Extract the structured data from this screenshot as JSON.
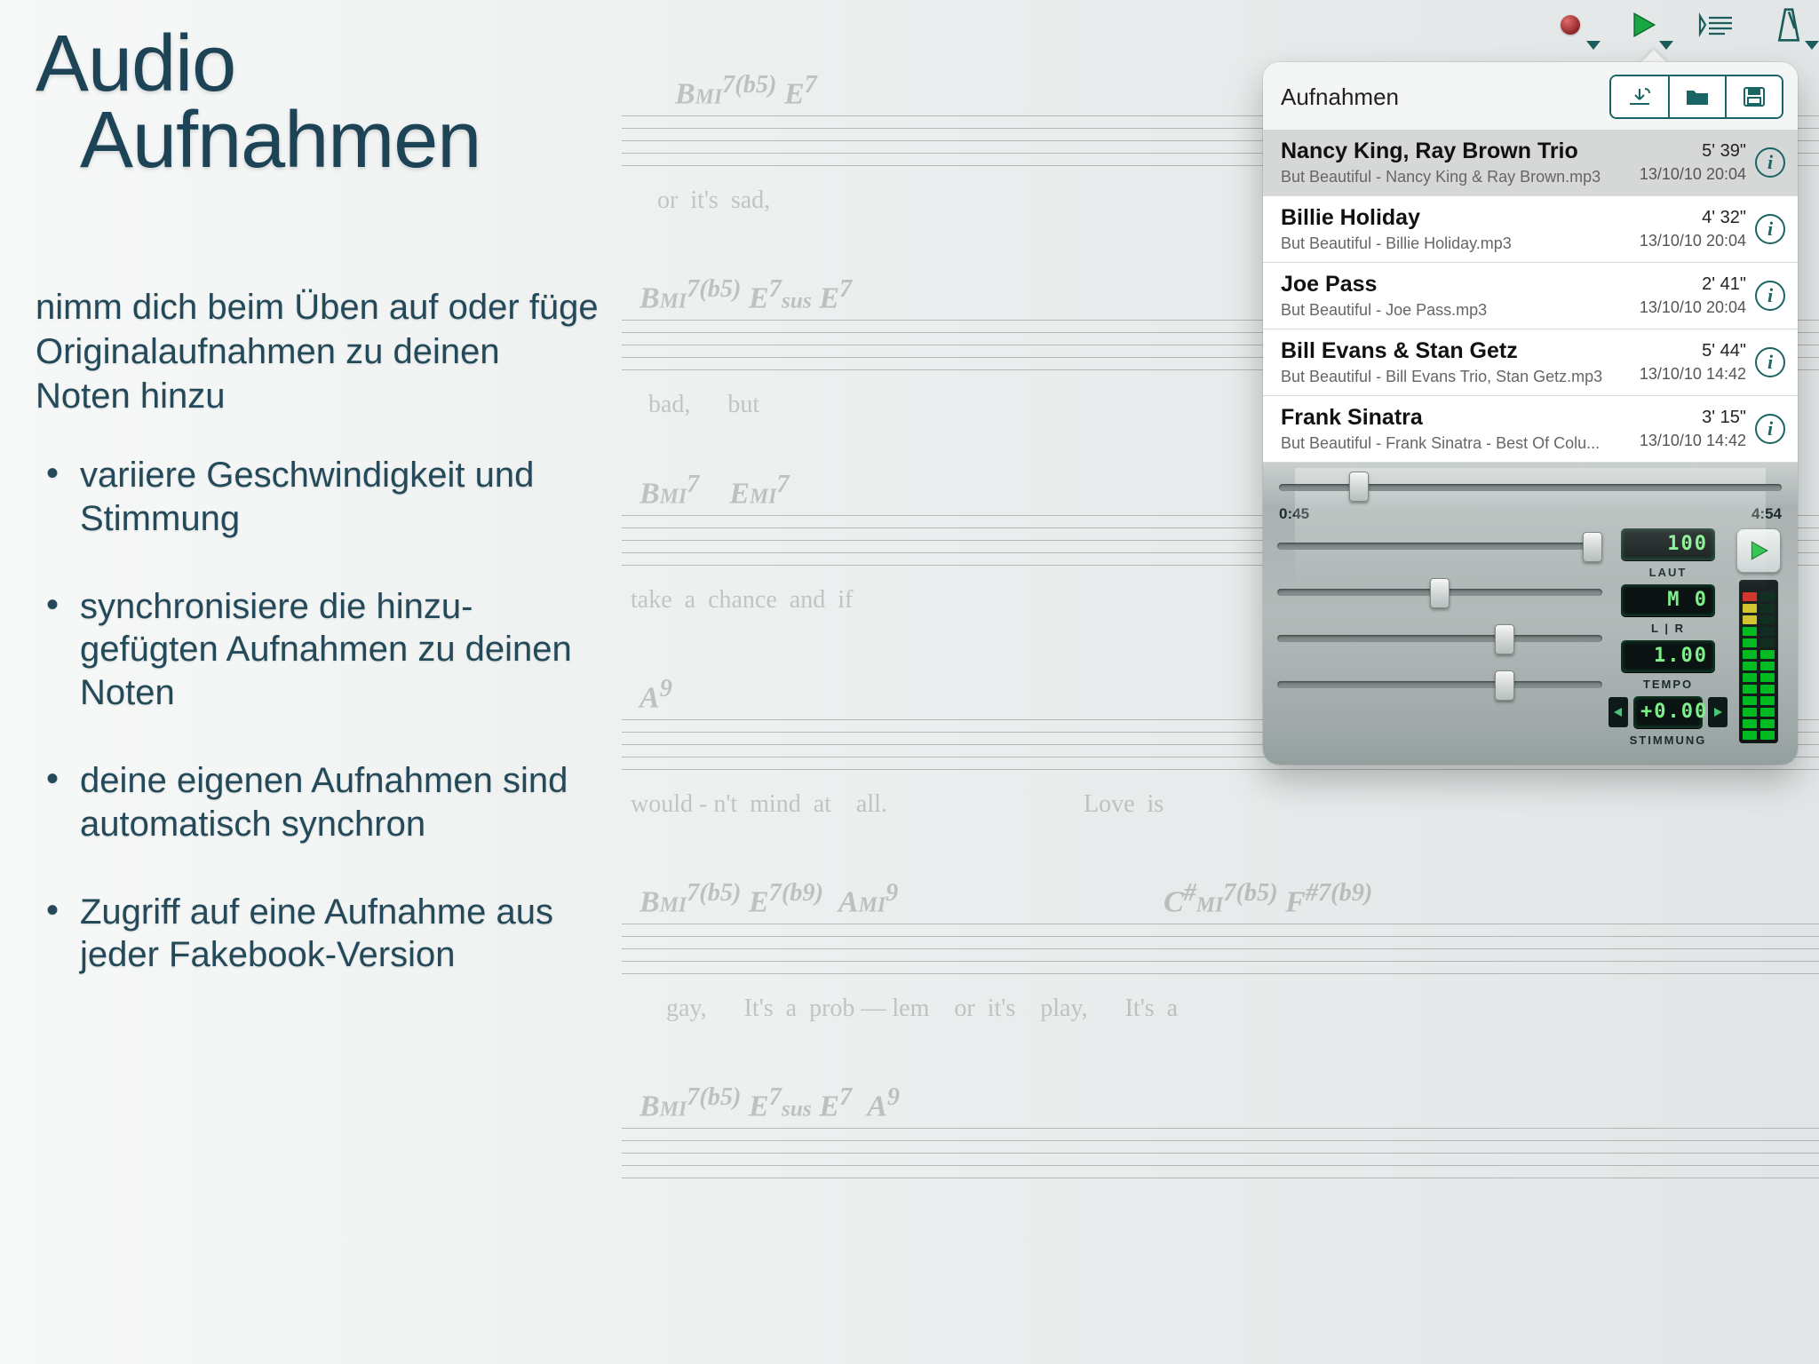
{
  "headline": {
    "line1": "Audio",
    "line2": "Aufnahmen"
  },
  "intro": "nimm dich beim Üben auf oder füge Originalaufnahmen zu deinen Noten hinzu",
  "bullets": [
    "variiere Geschwindigkeit und Stimmung",
    "synchronisiere die hinzu-gefügten Aufnahmen zu deinen Noten",
    "deine eigenen Aufnahmen sind automatisch synchron",
    "Zugriff auf eine Aufnahme aus jeder Fakebook-Version"
  ],
  "toolbar_icons": [
    "record-icon",
    "play-icon",
    "score-icon",
    "metronome-icon"
  ],
  "popover": {
    "title": "Aufnahmen",
    "seg_icons": [
      "import-icon",
      "folder-icon",
      "save-icon"
    ],
    "recordings": [
      {
        "title": "Nancy King, Ray Brown Trio",
        "file": "But Beautiful - Nancy King & Ray Brown.mp3",
        "dur": "5' 39\"",
        "date": "13/10/10 20:04",
        "selected": true
      },
      {
        "title": "Billie Holiday",
        "file": "But Beautiful - Billie Holiday.mp3",
        "dur": "4' 32\"",
        "date": "13/10/10 20:04",
        "selected": false
      },
      {
        "title": "Joe Pass",
        "file": "But Beautiful - Joe Pass.mp3",
        "dur": "2' 41\"",
        "date": "13/10/10 20:04",
        "selected": false
      },
      {
        "title": "Bill Evans & Stan Getz",
        "file": "But Beautiful - Bill Evans Trio, Stan Getz.mp3",
        "dur": "5' 44\"",
        "date": "13/10/10 14:42",
        "selected": false
      },
      {
        "title": "Frank Sinatra",
        "file": "But Beautiful - Frank Sinatra - Best Of Colu...",
        "dur": "3' 15\"",
        "date": "13/10/10 14:42",
        "selected": false
      }
    ],
    "controls": {
      "position": "0:45",
      "total": "4:54",
      "position_pct": 14,
      "sliders": [
        {
          "name": "volume",
          "label": "LAUT",
          "value": "100",
          "pct": 100
        },
        {
          "name": "pan",
          "label": "L | R",
          "value": "M   0",
          "pct": 50
        },
        {
          "name": "tempo",
          "label": "TEMPO",
          "value": "1.00",
          "pct": 70
        },
        {
          "name": "tuning",
          "label": "STIMMUNG",
          "value": "+0.00",
          "pct": 70
        }
      ]
    }
  },
  "colors": {
    "teal": "#1a6463",
    "headline": "#1d4456"
  }
}
